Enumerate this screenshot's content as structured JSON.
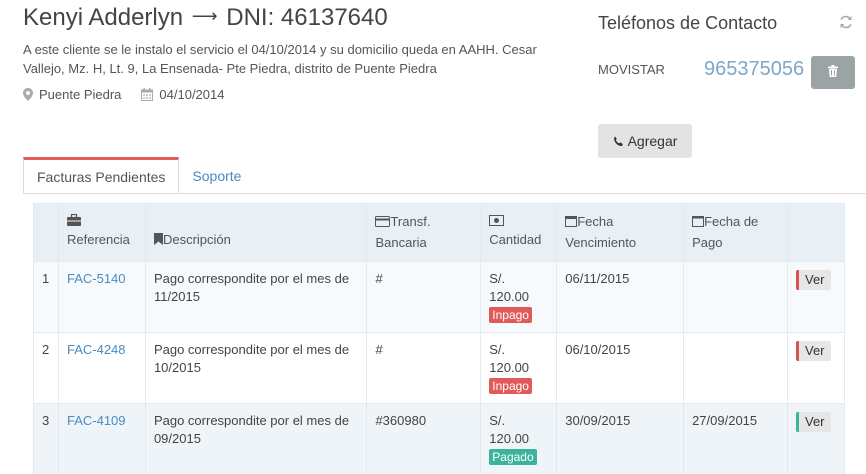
{
  "client": {
    "name": "Kenyi Adderlyn",
    "dni": "DNI: 46137640",
    "description": "A este cliente se le instalo el servicio el 04/10/2014 y su domicilio queda en AAHH. Cesar Vallejo, Mz. H, Lt. 9, La Ensenada- Pte Piedra, distrito de Puente Piedra",
    "district": "Puente Piedra",
    "date": "04/10/2014"
  },
  "contacts": {
    "title": "Teléfonos de Contacto",
    "operator": "MOVISTAR",
    "phone": "965375056",
    "add_label": "Agregar"
  },
  "tabs": [
    {
      "label": "Facturas Pendientes",
      "active": true
    },
    {
      "label": "Soporte",
      "active": false
    }
  ],
  "table": {
    "headers": {
      "ref": "Referencia",
      "desc": "Descripción",
      "transf": "Transf. Bancaria",
      "qty": "Cantidad",
      "due": "Fecha Vencimiento",
      "paid": "Fecha de Pago"
    },
    "rows": [
      {
        "n": "1",
        "ref": "FAC-5140",
        "desc": "Pago correspondite por el mes de 11/2015",
        "transf": "#",
        "amount": "S/. 120.00",
        "status": "Inpago",
        "due": "06/11/2015",
        "paid": "",
        "action": "Ver"
      },
      {
        "n": "2",
        "ref": "FAC-4248",
        "desc": "Pago correspondite por el mes de 10/2015",
        "transf": "#",
        "amount": "S/. 120.00",
        "status": "Inpago",
        "due": "06/10/2015",
        "paid": "",
        "action": "Ver"
      },
      {
        "n": "3",
        "ref": "FAC-4109",
        "desc": "Pago correspondite por el mes de 09/2015",
        "transf": "#360980",
        "amount": "S/. 120.00",
        "status": "Pagado",
        "due": "30/09/2015",
        "paid": "27/09/2015",
        "action": "Ver"
      }
    ]
  },
  "colors": {
    "accent": "#e25e5e",
    "link": "#4a8bc0",
    "phone": "#7ea7c7",
    "unpaid": "#e05a5a",
    "paid": "#3cb39a"
  }
}
